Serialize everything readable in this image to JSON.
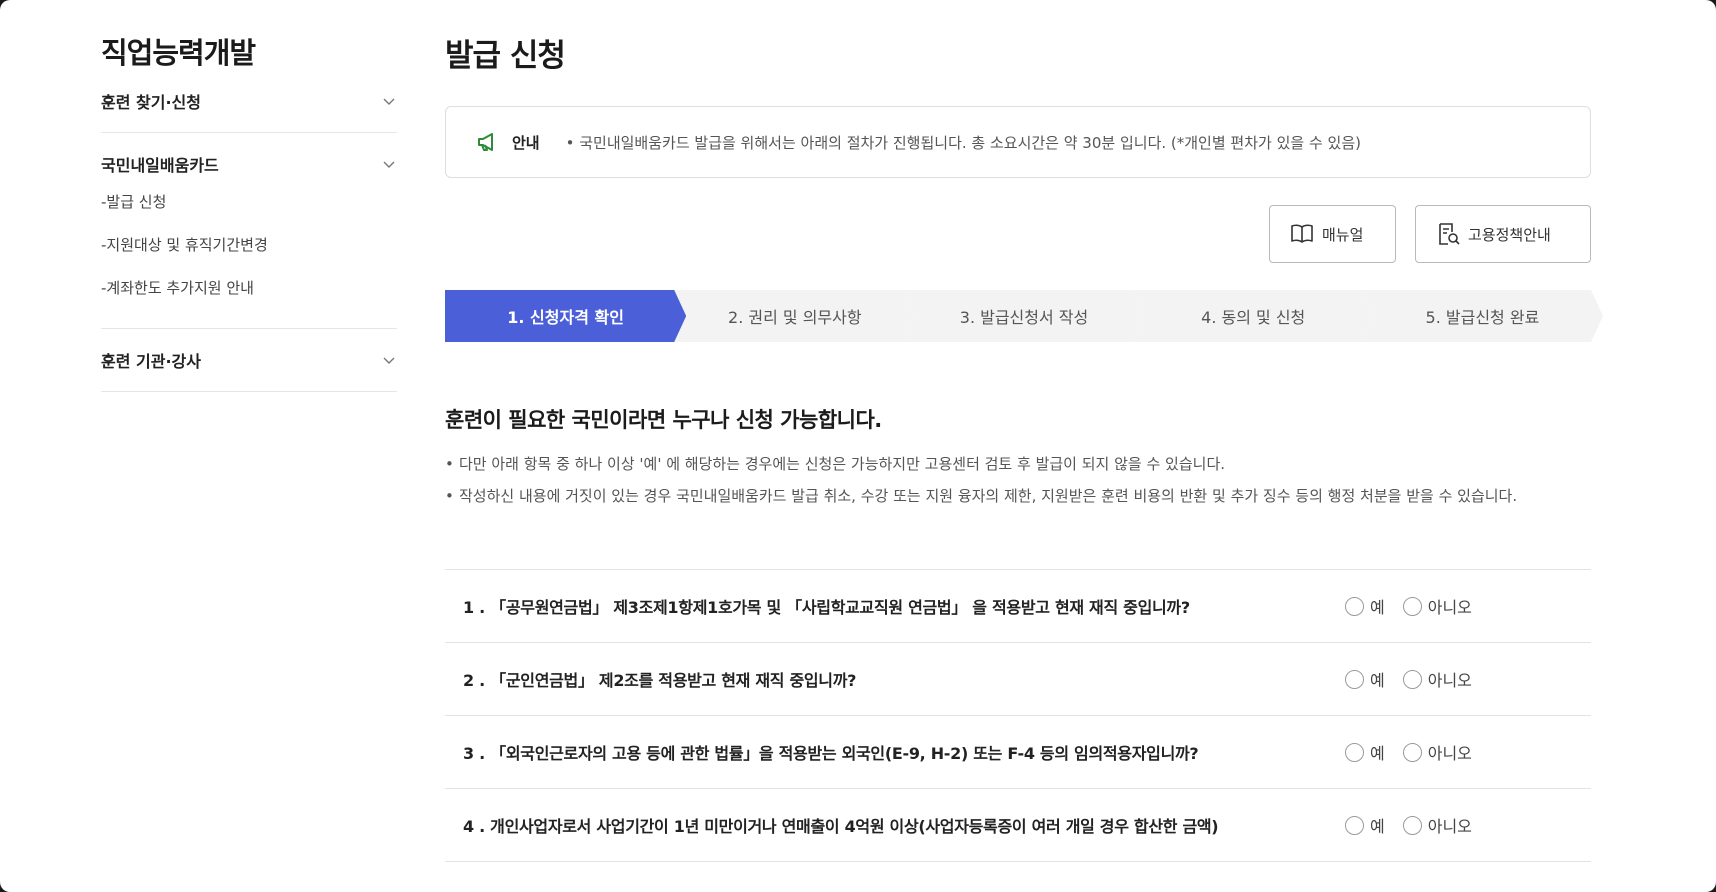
{
  "sidebar": {
    "title": "직업능력개발",
    "groups": [
      {
        "label": "훈련 찾기·신청",
        "items": []
      },
      {
        "label": "국민내일배움카드",
        "items": [
          "-발급 신청",
          "-지원대상 및 휴직기간변경",
          "-계좌한도 추가지원 안내"
        ]
      },
      {
        "label": "훈련 기관·강사",
        "items": []
      }
    ]
  },
  "main": {
    "title": "발급 신청",
    "notice": {
      "label": "안내",
      "text": "• 국민내일배움카드 발급을 위해서는 아래의 절차가 진행됩니다. 총 소요시간은 약 30분 입니다. (*개인별 편차가 있을 수 있음)"
    },
    "buttons": {
      "manual": "매뉴얼",
      "policy": "고용정책안내"
    },
    "steps": [
      "1. 신청자격 확인",
      "2. 권리 및 의무사항",
      "3. 발급신청서 작성",
      "4. 동의 및 신청",
      "5. 발급신청 완료"
    ],
    "headline": "훈련이 필요한 국민이라면 누구나 신청 가능합니다.",
    "bullets": [
      "다만 아래 항목 중 하나 이상 '예' 에 해당하는 경우에는 신청은 가능하지만 고용센터 검토 후 발급이 되지 않을 수 있습니다.",
      "작성하신 내용에 거짓이 있는 경우 국민내일배움카드 발급 취소, 수강 또는 지원 융자의 제한, 지원받은 훈련 비용의 반환 및 추가 징수 등의 행정 처분을 받을 수 있습니다."
    ],
    "questions": [
      "1 . 「공무원연금법」 제3조제1항제1호가목 및 「사립학교교직원 연금법」 을 적용받고 현재 재직 중입니까?",
      "2 . 「군인연금법」 제2조를 적용받고 현재 재직 중입니까?",
      "3 . 「외국인근로자의 고용 등에 관한 법률」을 적용받는 외국인(E-9, H-2) 또는 F-4 등의 임의적용자입니까?",
      "4 . 개인사업자로서 사업기간이 1년 미만이거나 연매출이 4억원 이상(사업자등록증이 여러 개일 경우 합산한 금액)"
    ],
    "yes": "예",
    "no": "아니오"
  },
  "colors": {
    "accent": "#4a5fd8",
    "notice_icon": "#2e8b3a"
  }
}
